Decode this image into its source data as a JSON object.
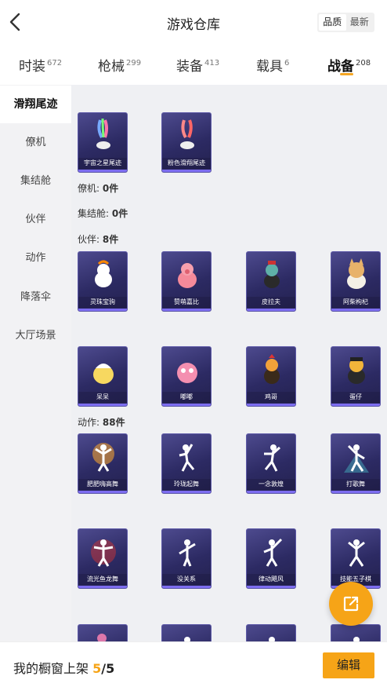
{
  "header": {
    "title": "游戏仓库",
    "sort_options": [
      "品质",
      "最新"
    ],
    "sort_selected": "品质"
  },
  "tabs": [
    {
      "label": "时装",
      "count": "672"
    },
    {
      "label": "枪械",
      "count": "299"
    },
    {
      "label": "装备",
      "count": "413"
    },
    {
      "label": "载具",
      "count": "6"
    },
    {
      "label": "战备",
      "count": "208",
      "active": true
    }
  ],
  "sidebar": {
    "items": [
      {
        "label": "滑翔尾迹",
        "active": true
      },
      {
        "label": "僚机"
      },
      {
        "label": "集结舱"
      },
      {
        "label": "伙伴"
      },
      {
        "label": "动作"
      },
      {
        "label": "降落伞"
      },
      {
        "label": "大厅场景"
      }
    ]
  },
  "sections": {
    "trails": {
      "items": [
        "宇宙之星尾迹",
        "粉色滑翔尾迹"
      ]
    },
    "wingman": {
      "label": "僚机:",
      "count": "0件"
    },
    "capsule": {
      "label": "集结舱:",
      "count": "0件"
    },
    "companion": {
      "label": "伙伴:",
      "count": "8件",
      "items": [
        "灵珠宝驹",
        "赞萌嘉比",
        "皮拉夫",
        "阿柴枸杞",
        "呆呆",
        "嘟嘟",
        "鸡哥",
        "蛋仔"
      ]
    },
    "emote": {
      "label": "动作:",
      "count": "88件",
      "items": [
        "肥肥嗨高舞",
        "玲珑起舞",
        "一念敦煌",
        "打歌舞",
        "流光鱼龙舞",
        "没关系",
        "律动飓风",
        "技能五子棋"
      ]
    }
  },
  "bottom": {
    "showcase_label": "我的橱窗上架",
    "current": "5",
    "separator": "/",
    "total": "5",
    "edit_label": "编辑"
  },
  "colors": {
    "accent": "#f6a417",
    "card_bg": "#2c2a63",
    "card_border": "#5e5aa8"
  }
}
